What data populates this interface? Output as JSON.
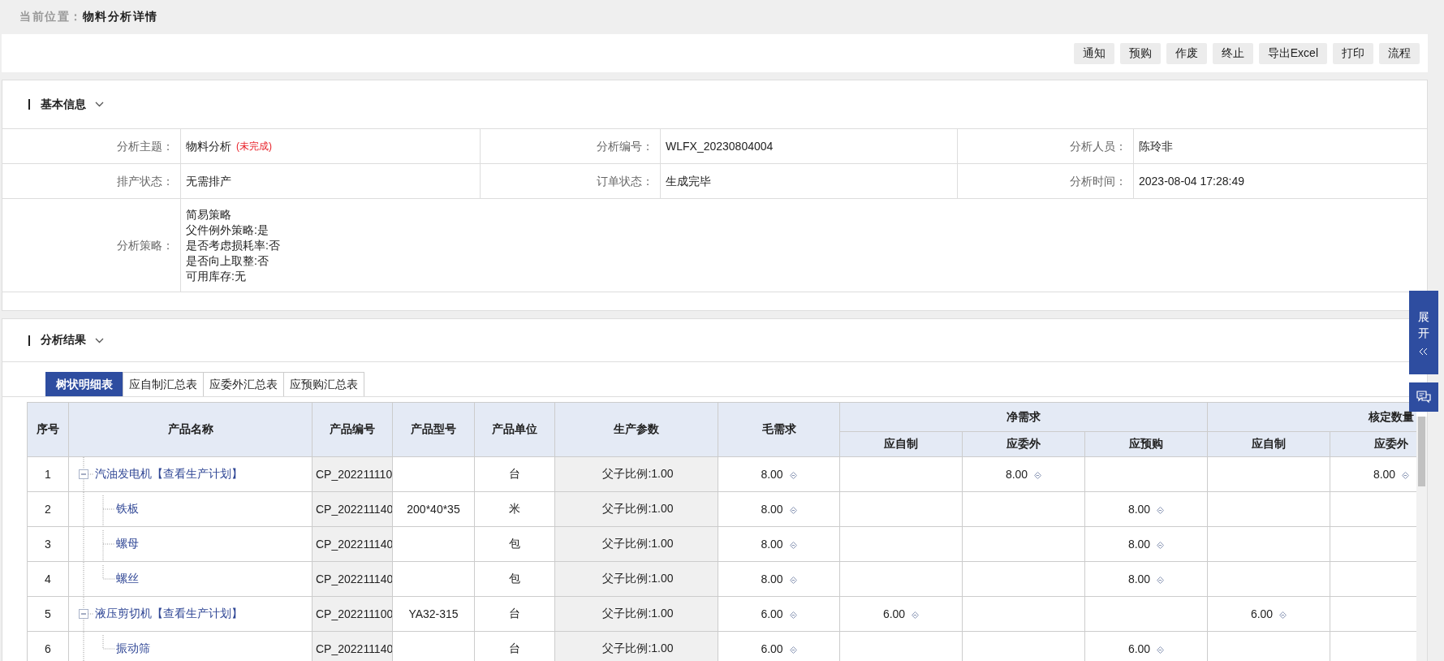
{
  "breadcrumb": {
    "label": "当前位置：",
    "current": "物料分析详情"
  },
  "toolbar": {
    "buttons": [
      "通知",
      "预购",
      "作废",
      "终止",
      "导出Excel",
      "打印",
      "流程"
    ]
  },
  "basic_info": {
    "title": "基本信息",
    "fields": [
      {
        "label": "分析主题：",
        "value": "物料分析",
        "note": "(未完成)"
      },
      {
        "label": "分析编号：",
        "value": "WLFX_20230804004"
      },
      {
        "label": "分析人员：",
        "value": "陈玲非"
      },
      {
        "label": "排产状态：",
        "value": "无需排产"
      },
      {
        "label": "订单状态：",
        "value": "生成完毕"
      },
      {
        "label": "分析时间：",
        "value": "2023-08-04 17:28:49"
      }
    ],
    "strategy": {
      "label": "分析策略：",
      "lines": [
        "简易策略",
        "父件例外策略:是",
        "是否考虑损耗率:否",
        "是否向上取整:否",
        "可用库存:无"
      ]
    }
  },
  "results": {
    "title": "分析结果",
    "tabs": [
      {
        "label": "树状明细表",
        "selected": true
      },
      {
        "label": "应自制汇总表",
        "selected": false
      },
      {
        "label": "应委外汇总表",
        "selected": false
      },
      {
        "label": "应预购汇总表",
        "selected": false
      }
    ],
    "table": {
      "columns": [
        "序号",
        "产品名称",
        "产品编号",
        "产品型号",
        "产品单位",
        "生产参数",
        "毛需求"
      ],
      "groups": [
        {
          "label": "净需求",
          "columns": [
            "应自制",
            "应委外",
            "应预购"
          ]
        },
        {
          "label": "核定数量",
          "columns": [
            "应自制",
            "应委外"
          ]
        }
      ],
      "rows": [
        {
          "seq": "1",
          "name": "汽油发电机",
          "link": "【查看生产计划】",
          "code": "CP_202211110",
          "unit": "台",
          "param": "父子比例:1.00",
          "gross": "8.00",
          "quantities": [
            {
              "kind": "blank"
            },
            {
              "kind": "value",
              "value": "8.00"
            },
            {
              "kind": "blank"
            },
            {
              "kind": "blank"
            },
            {
              "kind": "value",
              "value": "8.00"
            }
          ],
          "expanded": true,
          "children": [
            {
              "seq": "2",
              "name": "铁板",
              "code": "CP_202211140",
              "model": "200*40*35",
              "unit": "米",
              "param": "父子比例:1.00",
              "gross": "8.00",
              "quantities": [
                {
                  "kind": "blank"
                },
                {
                  "kind": "blank"
                },
                {
                  "kind": "value",
                  "value": "8.00"
                }
              ]
            },
            {
              "seq": "3",
              "name": "螺母",
              "code": "CP_202211140",
              "unit": "包",
              "param": "父子比例:1.00",
              "gross": "8.00",
              "quantities": [
                {
                  "kind": "blank"
                },
                {
                  "kind": "blank"
                },
                {
                  "kind": "value",
                  "value": "8.00"
                }
              ]
            },
            {
              "seq": "4",
              "name": "螺丝",
              "code": "CP_202211140",
              "unit": "包",
              "param": "父子比例:1.00",
              "gross": "8.00",
              "quantities": [
                {
                  "kind": "blank"
                },
                {
                  "kind": "blank"
                },
                {
                  "kind": "value",
                  "value": "8.00"
                }
              ]
            }
          ]
        },
        {
          "seq": "5",
          "name": "液压剪切机",
          "link": "【查看生产计划】",
          "code": "CP_202211100",
          "model": "YA32-315",
          "unit": "台",
          "param": "父子比例:1.00",
          "gross": "6.00",
          "quantities": [
            {
              "kind": "value",
              "value": "6.00"
            },
            {
              "kind": "blank"
            },
            {
              "kind": "blank"
            },
            {
              "kind": "value",
              "value": "6.00"
            }
          ],
          "expanded": true,
          "children": [
            {
              "seq": "6",
              "name": "振动筛",
              "code": "CP_202211140",
              "unit": "台",
              "param": "父子比例:1.00",
              "gross": "6.00",
              "quantities": [
                {
                  "kind": "blank"
                },
                {
                  "kind": "blank"
                },
                {
                  "kind": "value",
                  "value": "6.00"
                }
              ]
            }
          ]
        }
      ]
    }
  },
  "side_panel": {
    "label": "展开"
  }
}
